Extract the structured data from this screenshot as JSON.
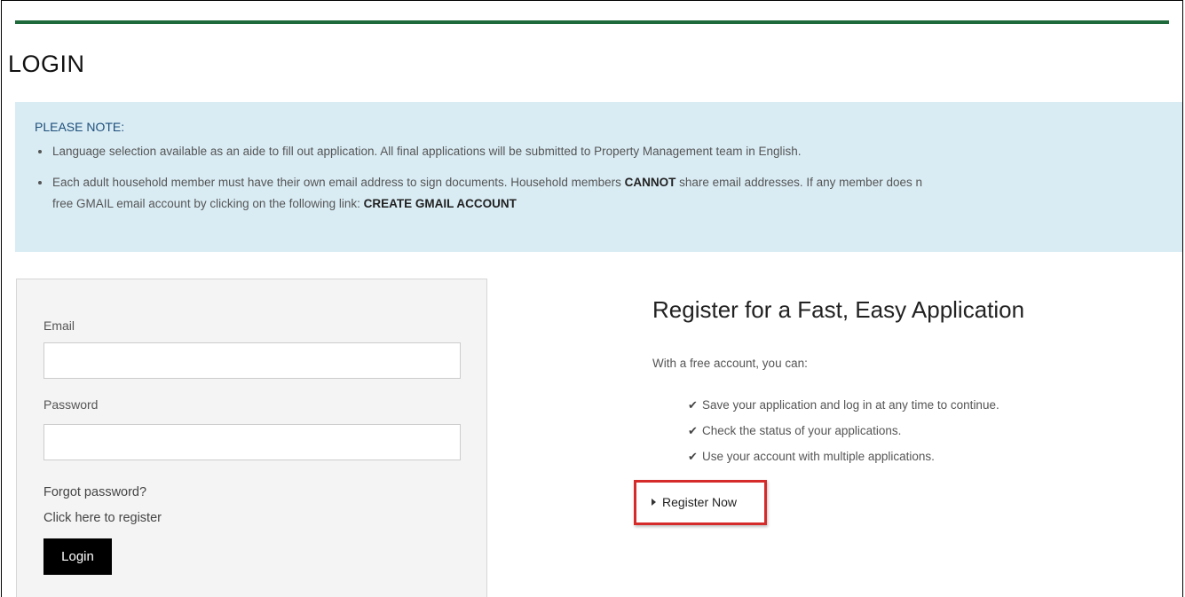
{
  "colors": {
    "top_bar": "#1f6a3b",
    "notice_background": "#d9ecf4",
    "notice_heading": "#1e4e7a",
    "highlight_border": "#d62b2b",
    "login_button": "#000000"
  },
  "page": {
    "title": "LOGIN"
  },
  "notice": {
    "heading": "PLEASE NOTE:",
    "item1": "Language selection available as an aide to fill out application.  All final applications will be submitted to Property Management team in English.",
    "item2_part1": "Each adult household member must have their own email address to sign documents.  Household members ",
    "item2_emphasis": "CANNOT",
    "item2_part2": " share email addresses. If any member does n",
    "item2_line2": "free GMAIL email account by clicking on the following link: ",
    "gmail_link": "CREATE GMAIL ACCOUNT"
  },
  "login": {
    "email_label": "Email",
    "email_value": "",
    "password_label": "Password",
    "password_value": "",
    "forgot_password": "Forgot password?",
    "register_link": "Click here to register",
    "login_button": "Login"
  },
  "register": {
    "heading": "Register for a Fast, Easy Application",
    "intro": "With a free account, you can:",
    "benefits": [
      "Save your application and log in at any time to continue.",
      "Check the status of your applications.",
      "Use your account with multiple applications."
    ],
    "benefit_icon": "check-icon",
    "register_now": "Register Now"
  }
}
